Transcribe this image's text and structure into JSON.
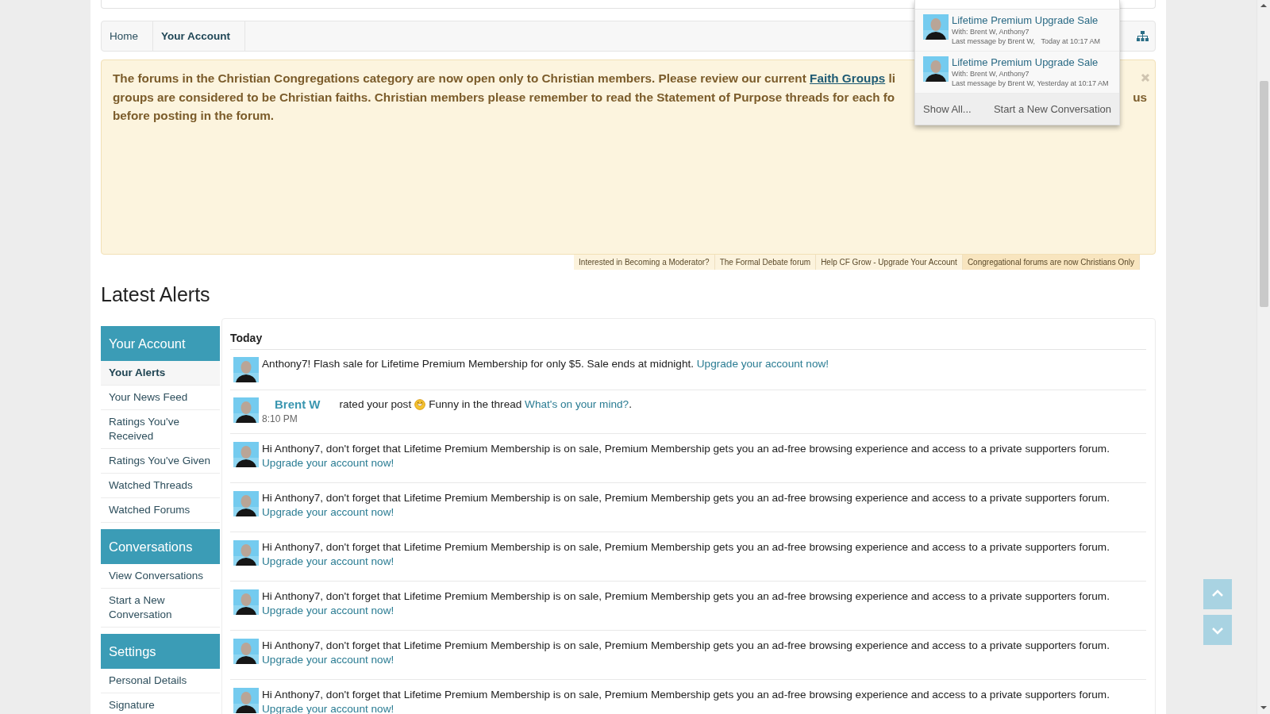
{
  "breadcrumb": [
    {
      "label": "Home",
      "selected": false
    },
    {
      "label": "Your Account",
      "selected": true
    }
  ],
  "notice": {
    "lines": [
      {
        "left": [
          {
            "kind": "text",
            "text": "The forums in the Christian Congregations category are now open only to Christian members. Please review our current "
          },
          {
            "kind": "link",
            "text": "Faith Groups"
          },
          {
            "kind": "text",
            "text": " li"
          }
        ]
      },
      {
        "left": [
          {
            "kind": "text",
            "text": "groups are considered to be Christian faiths. Christian members please remember to read the Statement of Purpose threads for each fo"
          }
        ],
        "right": "us"
      },
      {
        "left": [
          {
            "kind": "text",
            "text": "before posting in the forum."
          }
        ]
      }
    ]
  },
  "notice_tabs": [
    {
      "label": "Interested in Becoming a Moderator?",
      "selected": false
    },
    {
      "label": "The Formal Debate forum",
      "selected": false
    },
    {
      "label": "Help CF Grow - Upgrade Your Account",
      "selected": false
    },
    {
      "label": "Congregational forums are now Christians Only",
      "selected": true
    }
  ],
  "heading": "Latest Alerts",
  "sidebar": [
    {
      "title": "Your Account",
      "items": [
        {
          "label": "Your Alerts",
          "selected": true
        },
        {
          "label": "Your News Feed",
          "selected": false
        },
        {
          "label": "Ratings You've Received",
          "selected": false
        },
        {
          "label": "Ratings You've Given",
          "selected": false
        },
        {
          "label": "Watched Threads",
          "selected": false
        },
        {
          "label": "Watched Forums",
          "selected": false
        }
      ]
    },
    {
      "title": "Conversations",
      "items": [
        {
          "label": "View Conversations",
          "selected": false
        },
        {
          "label": "Start a New Conversation",
          "selected": false
        }
      ]
    },
    {
      "title": "Settings",
      "items": [
        {
          "label": "Personal Details",
          "selected": false
        },
        {
          "label": "Signature",
          "selected": false
        }
      ]
    }
  ],
  "alerts": {
    "day": "Today",
    "items": [
      {
        "kind": "inline",
        "text": "Anthony7! Flash sale for Lifetime Premium Membership for only $5. Sale ends at midnight.",
        "link": "Upgrade your account now!"
      },
      {
        "kind": "rating",
        "user": "Brent W",
        "action": "rated your post",
        "rating": "Funny in the thread",
        "link": "What's on your mind?",
        "end": ".",
        "time": "8:10 PM"
      },
      {
        "kind": "reminder",
        "text": "Hi Anthony7, don't forget that Lifetime Premium Membership is on sale, Premium Membership gets you an ad-free browsing experience and access to a private supporters forum.",
        "link": "Upgrade your account now!"
      },
      {
        "kind": "reminder",
        "text": "Hi Anthony7, don't forget that Lifetime Premium Membership is on sale, Premium Membership gets you an ad-free browsing experience and access to a private supporters forum.",
        "link": "Upgrade your account now!"
      },
      {
        "kind": "reminder",
        "text": "Hi Anthony7, don't forget that Lifetime Premium Membership is on sale, Premium Membership gets you an ad-free browsing experience and access to a private supporters forum.",
        "link": "Upgrade your account now!"
      },
      {
        "kind": "reminder",
        "text": "Hi Anthony7, don't forget that Lifetime Premium Membership is on sale, Premium Membership gets you an ad-free browsing experience and access to a private supporters forum.",
        "link": "Upgrade your account now!"
      },
      {
        "kind": "reminder",
        "text": "Hi Anthony7, don't forget that Lifetime Premium Membership is on sale, Premium Membership gets you an ad-free browsing experience and access to a private supporters forum.",
        "link": "Upgrade your account now!"
      },
      {
        "kind": "reminder",
        "text": "Hi Anthony7, don't forget that Lifetime Premium Membership is on sale, Premium Membership gets you an ad-free browsing experience and access to a private supporters forum.",
        "link": "Upgrade your account now!"
      }
    ]
  },
  "conversations": {
    "items": [
      {
        "title": "Lifetime Premium Upgrade Sale",
        "with": "With: Brent W, Anthony7",
        "last": "Last message by Brent W,   Today at 10:17 AM"
      },
      {
        "title": "Lifetime Premium Upgrade Sale",
        "with": "With: Brent W, Anthony7",
        "last": "Last message by Brent W, Yesterday at 10:17 AM"
      }
    ],
    "footer": [
      "Show All...",
      "Start a New Conversation"
    ]
  }
}
